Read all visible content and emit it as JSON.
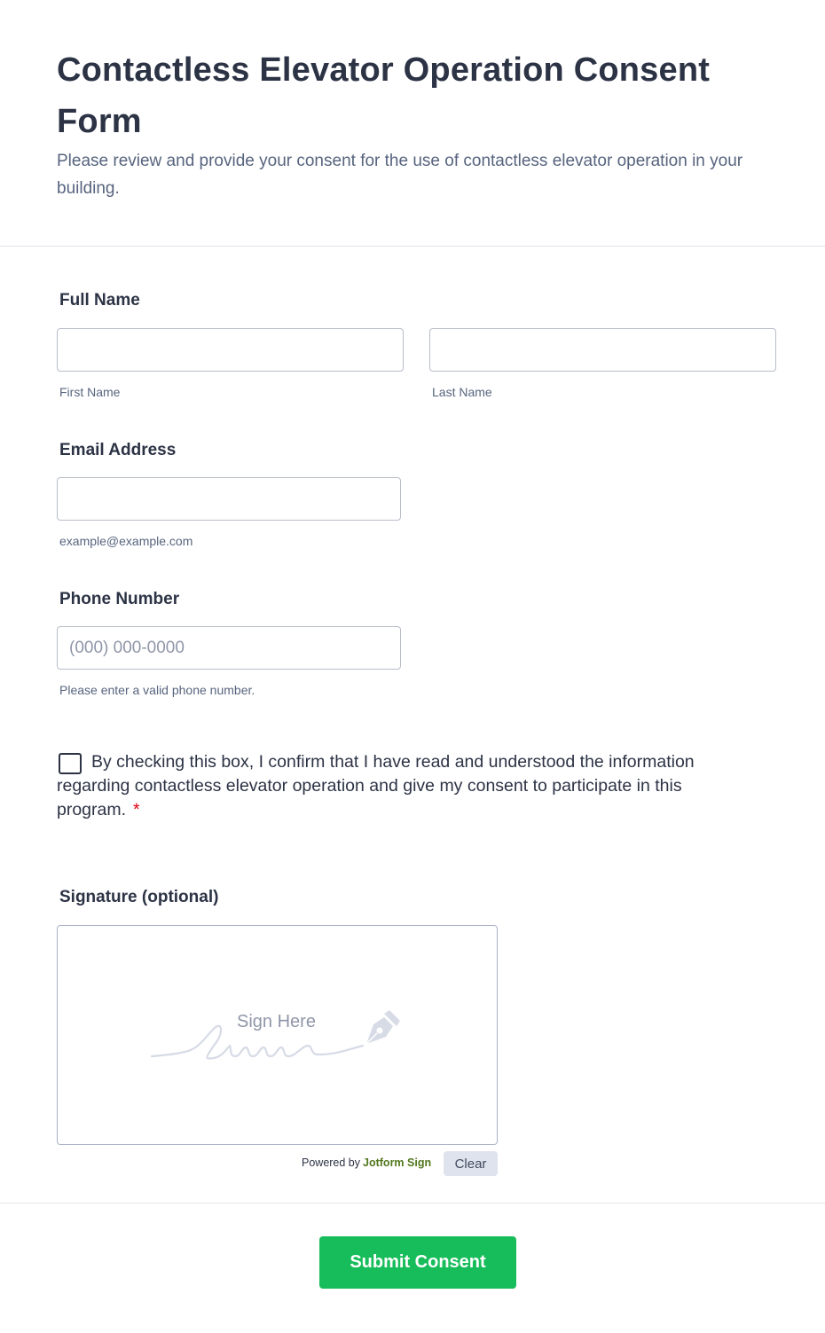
{
  "form": {
    "title": "Contactless Elevator Operation Consent Form",
    "subtitle": "Please review and provide your consent for the use of contactless elevator operation in your building."
  },
  "full_name": {
    "label": "Full Name",
    "first_value": "",
    "first_sublabel": "First Name",
    "last_value": "",
    "last_sublabel": "Last Name"
  },
  "email": {
    "label": "Email Address",
    "value": "",
    "sublabel": "example@example.com"
  },
  "phone": {
    "label": "Phone Number",
    "placeholder": "(000) 000-0000",
    "sublabel": "Please enter a valid phone number."
  },
  "consent": {
    "checked": false,
    "text": "By checking this box, I confirm that I have read and understood the information regarding contactless elevator operation and give my consent to participate in this program.",
    "required_mark": "*"
  },
  "signature": {
    "label": "Signature (optional)",
    "placeholder": "Sign Here",
    "powered_prefix": "Powered by",
    "powered_brand": "Jotform Sign",
    "clear_label": "Clear"
  },
  "submit": {
    "label": "Submit Consent"
  },
  "colors": {
    "submit_bg": "#18bd5b",
    "required": "#e3000f",
    "brand": "#51771d"
  },
  "icons": {
    "signature_pen": "pen-nib-icon"
  }
}
